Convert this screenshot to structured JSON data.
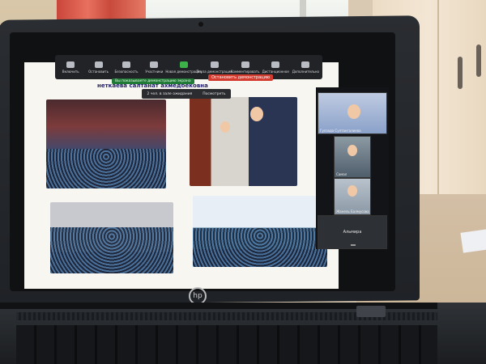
{
  "toolbar": {
    "items": [
      {
        "label": "Включить",
        "icon": "mic-icon"
      },
      {
        "label": "Остановить",
        "icon": "video-icon"
      },
      {
        "label": "Безопасность",
        "icon": "shield-icon"
      },
      {
        "label": "Участники",
        "icon": "participants-icon"
      },
      {
        "label": "Новая демонстрация",
        "icon": "share-icon"
      },
      {
        "label": "Пауза демонстрации",
        "icon": "pause-icon"
      },
      {
        "label": "Комментировать",
        "icon": "annotate-icon"
      },
      {
        "label": "Дистанционное",
        "icon": "remote-icon"
      },
      {
        "label": "Дополнительно",
        "icon": "more-icon"
      }
    ],
    "stop_share": "Остановить демонстрацию",
    "share_banner": "Вы показываете демонстрацию экрана"
  },
  "waiting_room": {
    "text": "2 чел. в зале ожидания",
    "view_label": "Посмотреть"
  },
  "slide": {
    "title": "неткаева салтанат ахмедбековна"
  },
  "participants": [
    {
      "name": "Гулзада Султангалиева"
    },
    {
      "name": "Самал"
    },
    {
      "name": "Жанель Балмусова"
    },
    {
      "name": "Альмира"
    }
  ],
  "laptop": {
    "brand": "hp"
  }
}
